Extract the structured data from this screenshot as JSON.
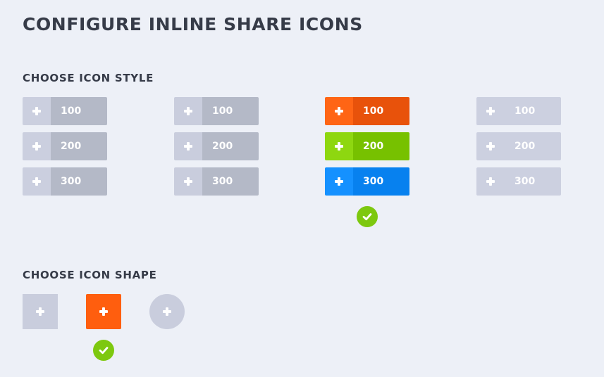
{
  "page": {
    "title": "CONFIGURE INLINE SHARE ICONS"
  },
  "style_section": {
    "title": "CHOOSE ICON STYLE",
    "selected_style": 3,
    "columns": [
      {
        "buttons": [
          {
            "label": "100",
            "icon_bg": "#cbcfdf",
            "label_bg": "#b4b9c7"
          },
          {
            "label": "200",
            "icon_bg": "#cbcfdf",
            "label_bg": "#b4b9c7"
          },
          {
            "label": "300",
            "icon_bg": "#cbcfdf",
            "label_bg": "#b4b9c7"
          }
        ]
      },
      {
        "buttons": [
          {
            "label": "100",
            "icon_bg": "#c9cddd",
            "label_bg": "#b4b9c7"
          },
          {
            "label": "200",
            "icon_bg": "#c9cddd",
            "label_bg": "#b4b9c7"
          },
          {
            "label": "300",
            "icon_bg": "#c9cddd",
            "label_bg": "#b4b9c7"
          }
        ]
      },
      {
        "buttons": [
          {
            "label": "100",
            "icon_bg": "#ff6515",
            "label_bg": "#e8520b"
          },
          {
            "label": "200",
            "icon_bg": "#8ed710",
            "label_bg": "#77c100"
          },
          {
            "label": "300",
            "icon_bg": "#1591ff",
            "label_bg": "#0781ef"
          }
        ]
      },
      {
        "buttons": [
          {
            "label": "100",
            "icon_bg": "#ccd0e0",
            "label_bg": "#ccd0e0"
          },
          {
            "label": "200",
            "icon_bg": "#ccd0e0",
            "label_bg": "#ccd0e0"
          },
          {
            "label": "300",
            "icon_bg": "#ccd0e0",
            "label_bg": "#ccd0e0"
          }
        ]
      }
    ]
  },
  "shape_section": {
    "title": "CHOOSE ICON SHAPE",
    "selected_shape": 2,
    "shapes": [
      {
        "shape": "square",
        "bg": "#c9cddd"
      },
      {
        "shape": "rounded",
        "bg": "#ff5e0e"
      },
      {
        "shape": "circle",
        "bg": "#c9cddd"
      }
    ]
  },
  "icons": {
    "plus": "plus-icon",
    "check": "checkmark-icon"
  },
  "colors": {
    "background": "#edf0f7",
    "heading": "#363b48",
    "check_green": "#7dc80f"
  }
}
